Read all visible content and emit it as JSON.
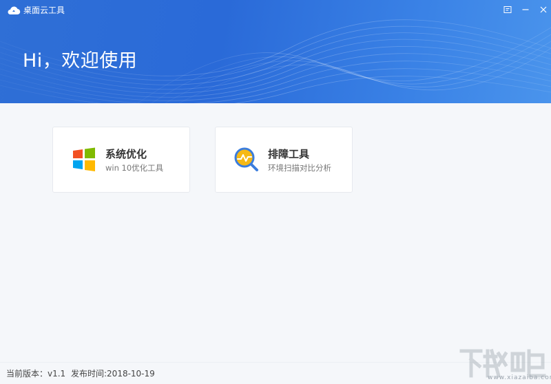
{
  "window": {
    "title": "桌面云工具",
    "buttons": {
      "menu_icon": "menu-icon",
      "minimize_icon": "minimize-icon",
      "close_icon": "close-icon"
    }
  },
  "header": {
    "greeting": "Hi，欢迎使用",
    "bg_color": "#2f6fd6"
  },
  "cards": [
    {
      "title": "系统优化",
      "subtitle": "win 10优化工具",
      "icon": "windows-icon"
    },
    {
      "title": "排障工具",
      "subtitle": "环境扫描对比分析",
      "icon": "magnifier-chart-icon"
    }
  ],
  "footer": {
    "version": "当前版本：v1.1",
    "release": "发布时间:2018-10-19"
  },
  "watermark": {
    "url": "www.xiazaiba.com"
  },
  "colors": {
    "accent": "#2f6fd6",
    "win_red": "#f25022",
    "win_green": "#7fba00",
    "win_blue": "#00a4ef",
    "win_yellow": "#ffb900",
    "magnifier_ring": "#3b7ddd",
    "magnifier_fill": "#f6b916"
  }
}
